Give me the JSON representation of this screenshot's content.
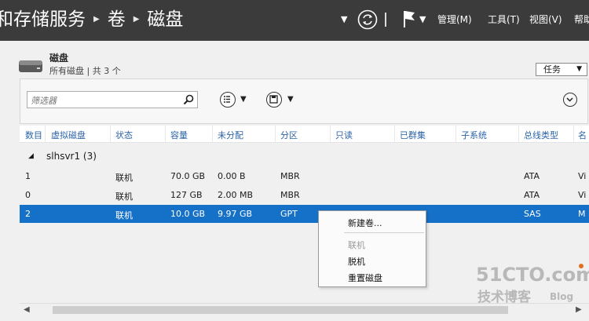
{
  "titlebar": {
    "breadcrumb": [
      "和存储服务",
      "卷",
      "磁盘"
    ],
    "menus": [
      "管理(M)",
      "工具(T)",
      "视图(V)",
      "帮助"
    ]
  },
  "section": {
    "title": "磁盘",
    "subtitle": "所有磁盘 | 共 3 个",
    "tasks_label": "任务"
  },
  "filter": {
    "placeholder": "筛选器"
  },
  "table": {
    "columns": [
      "数目",
      "虚拟磁盘",
      "状态",
      "容量",
      "未分配",
      "分区",
      "只读",
      "已群集",
      "子系统",
      "总线类型",
      "名"
    ],
    "group_label": "slhsvr1 (3)",
    "rows": [
      {
        "num": "1",
        "status": "联机",
        "capacity": "70.0 GB",
        "unalloc": "0.00 B",
        "partition": "MBR",
        "bus": "ATA",
        "name": "Vi"
      },
      {
        "num": "0",
        "status": "联机",
        "capacity": "127 GB",
        "unalloc": "2.00 MB",
        "partition": "MBR",
        "bus": "ATA",
        "name": "Vi"
      },
      {
        "num": "2",
        "status": "联机",
        "capacity": "10.0 GB",
        "unalloc": "9.97 GB",
        "partition": "GPT",
        "bus": "SAS",
        "name": "M"
      }
    ]
  },
  "context_menu": {
    "new_volume": "新建卷...",
    "online": "联机",
    "offline": "脱机",
    "reset_disk": "重置磁盘"
  },
  "watermark": {
    "site": "51CTO.com",
    "sub1": "技术博客",
    "sub2": "Blog"
  },
  "colors": {
    "titlebar": "#3b3b3b",
    "selection": "#1570c8",
    "header_text": "#2b63a8"
  }
}
